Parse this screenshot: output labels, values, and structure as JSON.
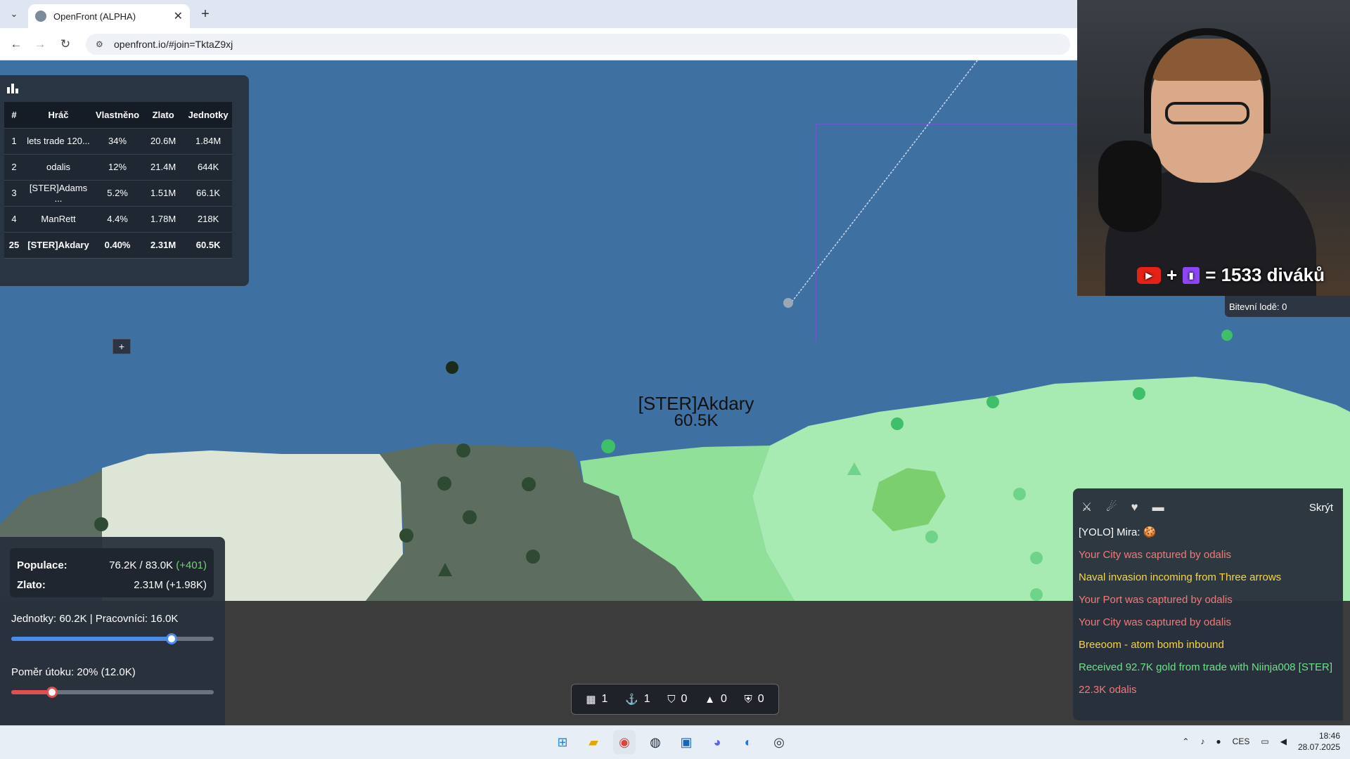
{
  "browser": {
    "tab_title": "OpenFront (ALPHA)",
    "tab_close": "✕",
    "new_tab": "+",
    "tab_menu": "⌄",
    "url": "openfront.io/#join=TktaZ9xj",
    "back": "←",
    "forward": "→",
    "reload": "↻"
  },
  "leaderboard": {
    "headers": [
      "#",
      "Hráč",
      "Vlastněno",
      "Zlato",
      "Jednotky"
    ],
    "rows": [
      {
        "rank": "1",
        "player": "lets trade 120...",
        "owned": "34%",
        "gold": "20.6M",
        "units": "1.84M"
      },
      {
        "rank": "2",
        "player": "odalis",
        "owned": "12%",
        "gold": "21.4M",
        "units": "644K"
      },
      {
        "rank": "3",
        "player": "[STER]Adams ...",
        "owned": "5.2%",
        "gold": "1.51M",
        "units": "66.1K"
      },
      {
        "rank": "4",
        "player": "ManRett",
        "owned": "4.4%",
        "gold": "1.78M",
        "units": "218K"
      },
      {
        "rank": "25",
        "player": "[STER]Akdary",
        "owned": "0.40%",
        "gold": "2.31M",
        "units": "60.5K"
      }
    ],
    "expand": "+"
  },
  "map": {
    "player_name": "[STER]Akdary",
    "player_troops": "60.5K"
  },
  "stats": {
    "population_label": "Populace:",
    "population_value": "76.2K / 83.0K",
    "population_delta": "(+401)",
    "gold_label": "Zlato:",
    "gold_value": "2.31M (+1.98K)",
    "troops_line": "Jednotky: 60.2K | Pracovníci: 16.0K",
    "troops_ratio": 0.79,
    "attack_line": "Poměr útoku: 20% (12.0K)",
    "attack_ratio": 0.2,
    "troops_color": "#4a8be8",
    "attack_color": "#e05050"
  },
  "buildbar": {
    "city": "1",
    "port": "1",
    "defense": "0",
    "missile": "0",
    "sam": "0"
  },
  "events": {
    "hide": "Skrýt",
    "items": [
      {
        "text": "[YOLO] Mira: 🍪",
        "color": "#ffffff"
      },
      {
        "text": "Your City was captured by odalis",
        "color": "#f07a7a"
      },
      {
        "text": "Naval invasion incoming from Three arrows",
        "color": "#f5d547"
      },
      {
        "text": "Your Port was captured by odalis",
        "color": "#f07a7a"
      },
      {
        "text": "Your City was captured by odalis",
        "color": "#f07a7a"
      },
      {
        "text": "Breeoom - atom bomb inbound",
        "color": "#f5d547"
      },
      {
        "text": "Received 92.7K gold from trade with Niinja008 [STER]",
        "color": "#6fe08a"
      },
      {
        "text": "22.3K odalis",
        "color": "#f07a7a"
      }
    ]
  },
  "stream": {
    "viewers_text": "= 1533 diváků",
    "plus": "+",
    "battleships": "Bitevní lodě: 0"
  },
  "taskbar": {
    "lang": "CES",
    "time": "18:46",
    "date": "28.07.2025"
  }
}
